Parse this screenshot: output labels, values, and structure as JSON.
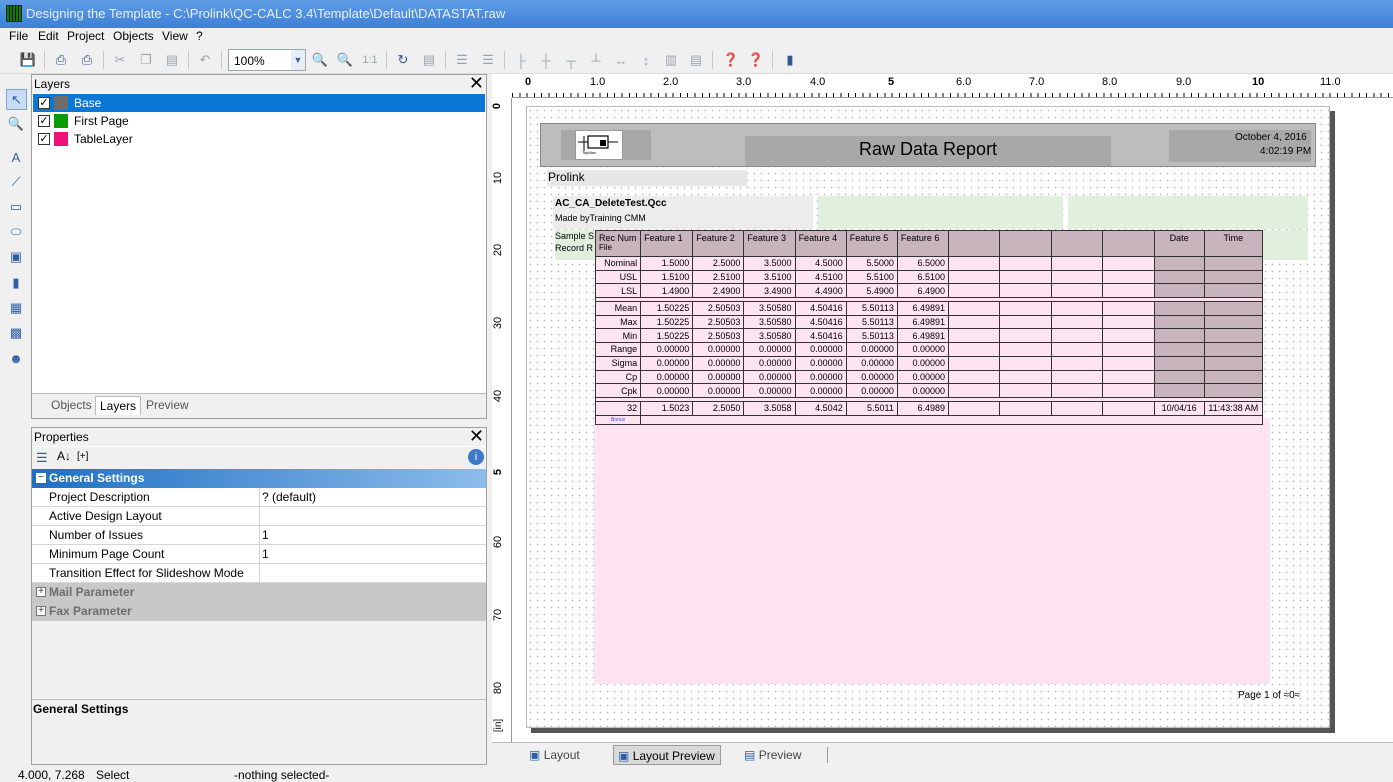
{
  "window": {
    "title": "Designing the Template - C:\\Prolink\\QC-CALC 3.4\\Template\\Default\\DATASTAT.raw"
  },
  "menu": [
    "File",
    "Edit",
    "Project",
    "Objects",
    "View",
    "?"
  ],
  "toolbar": {
    "zoom": "100%",
    "ratio": "1:1"
  },
  "layers_panel": {
    "title": "Layers",
    "items": [
      {
        "name": "Base",
        "color": "#6d6d6d",
        "checked": true
      },
      {
        "name": "First Page",
        "color": "#0a9a0a",
        "checked": true
      },
      {
        "name": "TableLayer",
        "color": "#ee1177",
        "checked": true
      }
    ],
    "tabs": [
      "Objects",
      "Layers",
      "Preview"
    ]
  },
  "properties_panel": {
    "title": "Properties",
    "sort_label": "[+]",
    "group": "General Settings",
    "rows": [
      {
        "key": "Project Description",
        "value": "? (default)"
      },
      {
        "key": "Active Design Layout",
        "value": ""
      },
      {
        "key": "Number of Issues",
        "value": "1"
      },
      {
        "key": "Minimum Page Count",
        "value": "1"
      },
      {
        "key": "Transition Effect for Slideshow Mode",
        "value": ""
      }
    ],
    "collapsed_groups": [
      "Mail Parameter",
      "Fax Parameter"
    ],
    "description_title": "General Settings"
  },
  "ruler": {
    "top": [
      "0",
      "1.0",
      "2.0",
      "3.0",
      "4.0",
      "5",
      "6.0",
      "7.0",
      "8.0",
      "9.0",
      "10",
      "11.0"
    ],
    "left": [
      "0",
      "10",
      "20",
      "30",
      "40",
      "5",
      "60",
      "70",
      "80"
    ],
    "unit": "[in]"
  },
  "report": {
    "title": "Raw Data Report",
    "date": "October 4, 2016",
    "time": "4:02:19 PM",
    "company": "Prolink",
    "file": "AC_CA_DeleteTest.Qcc",
    "made_by": "Made byTraining CMM",
    "sample_label": "Sample S",
    "record_label": "Record R",
    "logo_label": "TayMax",
    "page_label": "Page",
    "page_num": "1",
    "page_of": "of",
    "page_total": "≈0≈",
    "table": {
      "headers": [
        "Rec Num",
        "Feature 1",
        "Feature 2",
        "Feature 3",
        "Feature 4",
        "Feature 5",
        "Feature 6",
        "",
        "",
        "",
        "",
        "Date",
        "Time"
      ],
      "sub_header": "File",
      "limits": [
        [
          "Nominal",
          "1.5000",
          "2.5000",
          "3.5000",
          "4.5000",
          "5.5000",
          "6.5000"
        ],
        [
          "USL",
          "1.5100",
          "2.5100",
          "3.5100",
          "4.5100",
          "5.5100",
          "6.5100"
        ],
        [
          "LSL",
          "1.4900",
          "2.4900",
          "3.4900",
          "4.4900",
          "5.4900",
          "6.4900"
        ]
      ],
      "stats": [
        [
          "Mean",
          "1.50225",
          "2.50503",
          "3.50580",
          "4.50416",
          "5.50113",
          "6.49891"
        ],
        [
          "Max",
          "1.50225",
          "2.50503",
          "3.50580",
          "4.50416",
          "5.50113",
          "6.49891"
        ],
        [
          "Min",
          "1.50225",
          "2.50503",
          "3.50580",
          "4.50416",
          "5.50113",
          "6.49891"
        ],
        [
          "Range",
          "0.00000",
          "0.00000",
          "0.00000",
          "0.00000",
          "0.00000",
          "0.00000"
        ],
        [
          "Sigma",
          "0.00000",
          "0.00000",
          "0.00000",
          "0.00000",
          "0.00000",
          "0.00000"
        ],
        [
          "Cp",
          "0.00000",
          "0.00000",
          "0.00000",
          "0.00000",
          "0.00000",
          "0.00000"
        ],
        [
          "Cpk",
          "0.00000",
          "0.00000",
          "0.00000",
          "0.00000",
          "0.00000",
          "0.00000"
        ]
      ],
      "data_row": [
        "32",
        "1.5023",
        "2.5050",
        "3.5058",
        "4.5042",
        "5.5011",
        "6.4989",
        "",
        "",
        "",
        "",
        "10/04/16",
        "11:43:38 AM"
      ],
      "tiny_label": "Bonus"
    }
  },
  "bottom_tabs": [
    "Layout",
    "Layout Preview",
    "Preview"
  ],
  "status": {
    "coords": "4.000, 7.268",
    "mode": "Select",
    "selection": "-nothing selected-"
  }
}
